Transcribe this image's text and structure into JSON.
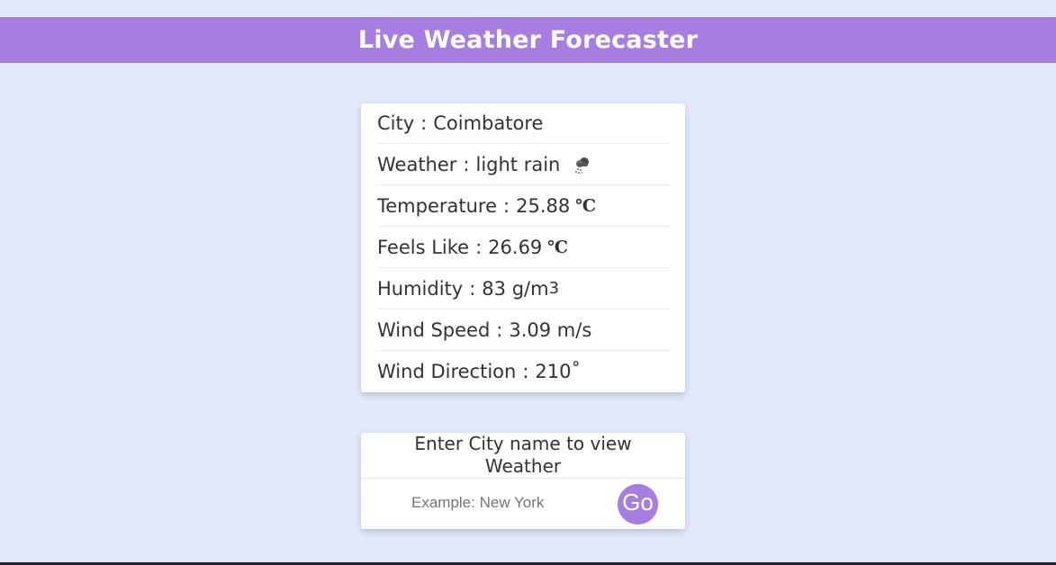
{
  "header": {
    "title": "Live Weather Forecaster"
  },
  "weather": {
    "city": {
      "label": "City",
      "sep": ":",
      "value": "Coimbatore"
    },
    "condition": {
      "label": "Weather",
      "sep": ":",
      "value": "light rain",
      "icon": "light-rain-icon"
    },
    "temperature": {
      "label": "Temperature",
      "sep": ":",
      "value": "25.88",
      "unit": "℃"
    },
    "feels_like": {
      "label": "Feels Like",
      "sep": ":",
      "value": "26.69",
      "unit": "℃"
    },
    "humidity": {
      "label": "Humidity",
      "sep": ":",
      "value": "83 g/m",
      "unit": "3"
    },
    "wind_speed": {
      "label": "Wind Speed",
      "sep": ":",
      "value": "3.09 m/s"
    },
    "wind_direction": {
      "label": "Wind Direction",
      "sep": ":",
      "value": "210˚"
    }
  },
  "search": {
    "title": "Enter City name to view Weather",
    "placeholder": "Example: New York",
    "value": "",
    "button_label": "Go"
  },
  "colors": {
    "background": "#e3e8fc",
    "accent": "#a67ee2",
    "card": "#ffffff",
    "text": "#333333"
  }
}
